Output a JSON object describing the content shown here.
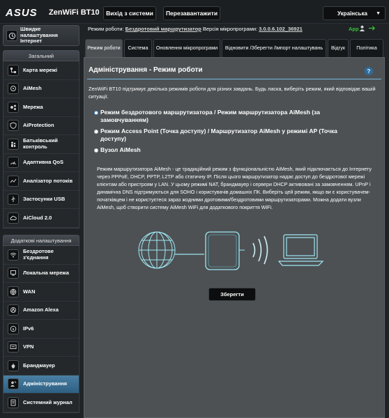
{
  "header": {
    "brand": "ASUS",
    "model": "ZenWiFi BT10",
    "logout_label": "Вихід з системи",
    "reboot_label": "Перезавантажити",
    "language": "Українська"
  },
  "status": {
    "mode_label": "Режим роботи:",
    "mode_value": "Бездротовий маршрутизатор",
    "firmware_label": "Версія мікропрограми:",
    "firmware_value": "3.0.0.6.102_36921",
    "app_label": "App"
  },
  "sidebar": {
    "quick_setup": "Швидке налаштування Інтернет",
    "general_header": "Загальний",
    "general_items": [
      {
        "label": "Карта мережі",
        "icon": "network-map-icon"
      },
      {
        "label": "AiMesh",
        "icon": "aimesh-icon"
      },
      {
        "label": "Мережа",
        "icon": "network-icon"
      },
      {
        "label": "AiProtection",
        "icon": "aiprotection-icon"
      },
      {
        "label": "Батьківський контроль",
        "icon": "parental-control-icon"
      },
      {
        "label": "Адаптивна QoS",
        "icon": "qos-icon"
      },
      {
        "label": "Аналізатор потоків",
        "icon": "traffic-analyzer-icon"
      },
      {
        "label": "Застосунки USB",
        "icon": "usb-icon"
      },
      {
        "label": "AiCloud 2.0",
        "icon": "aicloud-icon"
      }
    ],
    "advanced_header": "Додаткові налаштування",
    "advanced_items": [
      {
        "label": "Бездротове з'єднання",
        "icon": "wireless-icon"
      },
      {
        "label": "Локальна мережа",
        "icon": "lan-icon"
      },
      {
        "label": "WAN",
        "icon": "wan-icon"
      },
      {
        "label": "Amazon Alexa",
        "icon": "alexa-icon"
      },
      {
        "label": "IPv6",
        "icon": "ipv6-icon"
      },
      {
        "label": "VPN",
        "icon": "vpn-icon"
      },
      {
        "label": "Брандмауер",
        "icon": "firewall-icon"
      },
      {
        "label": "Адміністрування",
        "icon": "administration-icon"
      },
      {
        "label": "Системний журнал",
        "icon": "system-log-icon"
      }
    ]
  },
  "tabs": [
    {
      "label": "Режим роботи"
    },
    {
      "label": "Система"
    },
    {
      "label": "Оновлення мікропрограми"
    },
    {
      "label": "Відновити /Зберегти /Імпорт налаштувань"
    },
    {
      "label": "Відгук"
    },
    {
      "label": "Політика"
    }
  ],
  "panel": {
    "title": "Адміністрування - Режим роботи",
    "description": "ZenWiFi BT10 підтримує декілька режимів роботи для різних завдань. Будь ласка, виберіть режим, який відповідає вашій ситуації.",
    "options": [
      {
        "label": "Режим бездротового маршрутизатора / Режим маршрутизатора AiMesh (за замовчуванням)",
        "selected": true
      },
      {
        "label": "Режим Access Point (Точка доступу) / Маршрутизатор AiMesh у режимі AP (Точка доступу)",
        "selected": false
      },
      {
        "label": "Вузол AiMesh",
        "selected": false
      }
    ],
    "mode_description": "Режим маршрутизатора AiMesh - це традиційний режим з функціональністю AiMesh, який підключається до Інтернету через PPPoE, DHCP, PPTP, L2TP або статичну IP. Після цього маршрутизатор надає доступ до бездротової мережі клієнтам або пристроям у LAN. У цьому режимі NAT, брандмауер і сервери DHCP активовані за замовченням. UPnP і динамічна DNS підтримуються для SOHO і користувачів домашніх ПК. Виберіть цей режим, якщо ви є користувачем-початківцем і не користуєтеся зараз жодними дротовими/бездротовими маршрутизаторами. Можна додати вузли AiMesh, щоб створити систему AiMesh WiFi для додаткового покриття WiFi.",
    "apply_label": "Зберегти",
    "help_label": "?"
  },
  "colors": {
    "accent": "#79b7df",
    "active_nav": "#3d7199",
    "panel_bg": "#4d5154",
    "app_green": "#39c43b"
  }
}
